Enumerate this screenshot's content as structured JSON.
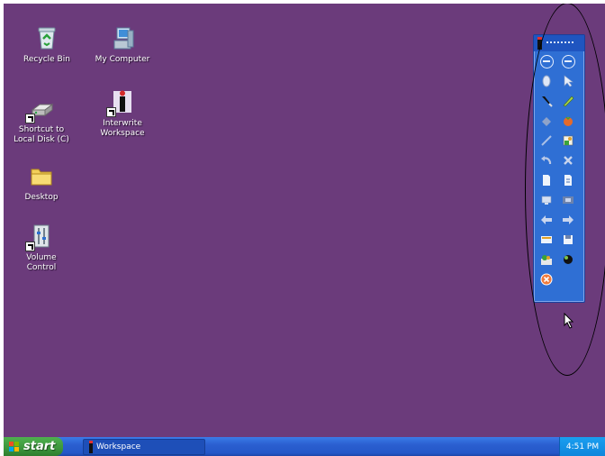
{
  "desktop": {
    "icons": [
      {
        "label": "Recycle Bin",
        "icon": "recycle-bin-icon"
      },
      {
        "label": "My Computer",
        "icon": "computer-icon"
      },
      {
        "label": "Shortcut to\nLocal Disk (C)",
        "icon": "disk-drive-icon"
      },
      {
        "label": "Interwrite\nWorkspace",
        "icon": "interwrite-icon"
      },
      {
        "label": "Desktop",
        "icon": "folder-icon"
      },
      {
        "label": "Volume\nControl",
        "icon": "volume-control-icon"
      }
    ],
    "background_color": "#6b3b7b"
  },
  "toolbar": {
    "buttons": [
      "minimize-circle-icon",
      "minimize-circle-icon",
      "mouse-icon",
      "arrow-pointer-icon",
      "pen-icon",
      "highlighter-icon",
      "eraser-icon",
      "tomato-icon",
      "line-tool-icon",
      "insert-object-icon",
      "undo-icon",
      "delete-icon",
      "new-page-icon",
      "pages-icon",
      "screen-capture-icon",
      "film-icon",
      "back-arrow-icon",
      "forward-arrow-icon",
      "keyboard-icon",
      "save-icon",
      "tools-icon",
      "eye-icon",
      "close-circle-icon"
    ]
  },
  "taskbar": {
    "start_label": "start",
    "task_label": "Workspace",
    "time": "4:51 PM"
  }
}
